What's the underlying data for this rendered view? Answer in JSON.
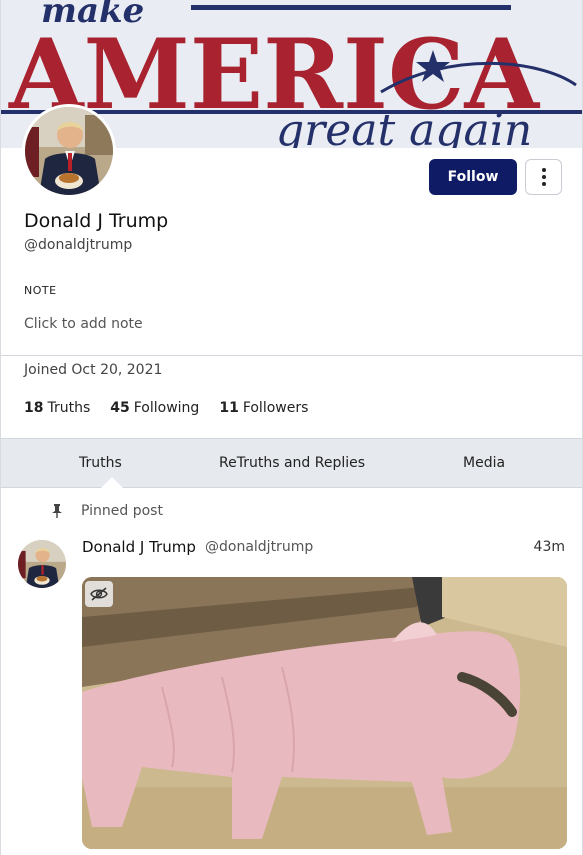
{
  "banner": {
    "line1": "make",
    "line2": "AMERICA",
    "line3": "great again",
    "colors": {
      "red": "#a8232f",
      "navy": "#24306a",
      "background": "#e9ecf2"
    }
  },
  "profile": {
    "display_name": "Donald J Trump",
    "handle": "@donaldjtrump",
    "follow_label": "Follow",
    "more_icon": "more-vertical-icon",
    "note_label": "NOTE",
    "note_placeholder": "Click to add note",
    "joined": "Joined Oct 20, 2021",
    "stats": {
      "truths_count": "18",
      "truths_label": "Truths",
      "following_count": "45",
      "following_label": "Following",
      "followers_count": "11",
      "followers_label": "Followers"
    }
  },
  "tabs": [
    {
      "label": "Truths",
      "active": true
    },
    {
      "label": "ReTruths and Replies",
      "active": false
    },
    {
      "label": "Media",
      "active": false
    }
  ],
  "post": {
    "pinned_label": "Pinned post",
    "author_name": "Donald J Trump",
    "author_handle": "@donaldjtrump",
    "time": "43m",
    "media_toggle_icon": "eye-off-icon"
  },
  "theme": {
    "accent": "#0f1b64",
    "tab_bar": "#e6e9ee"
  }
}
